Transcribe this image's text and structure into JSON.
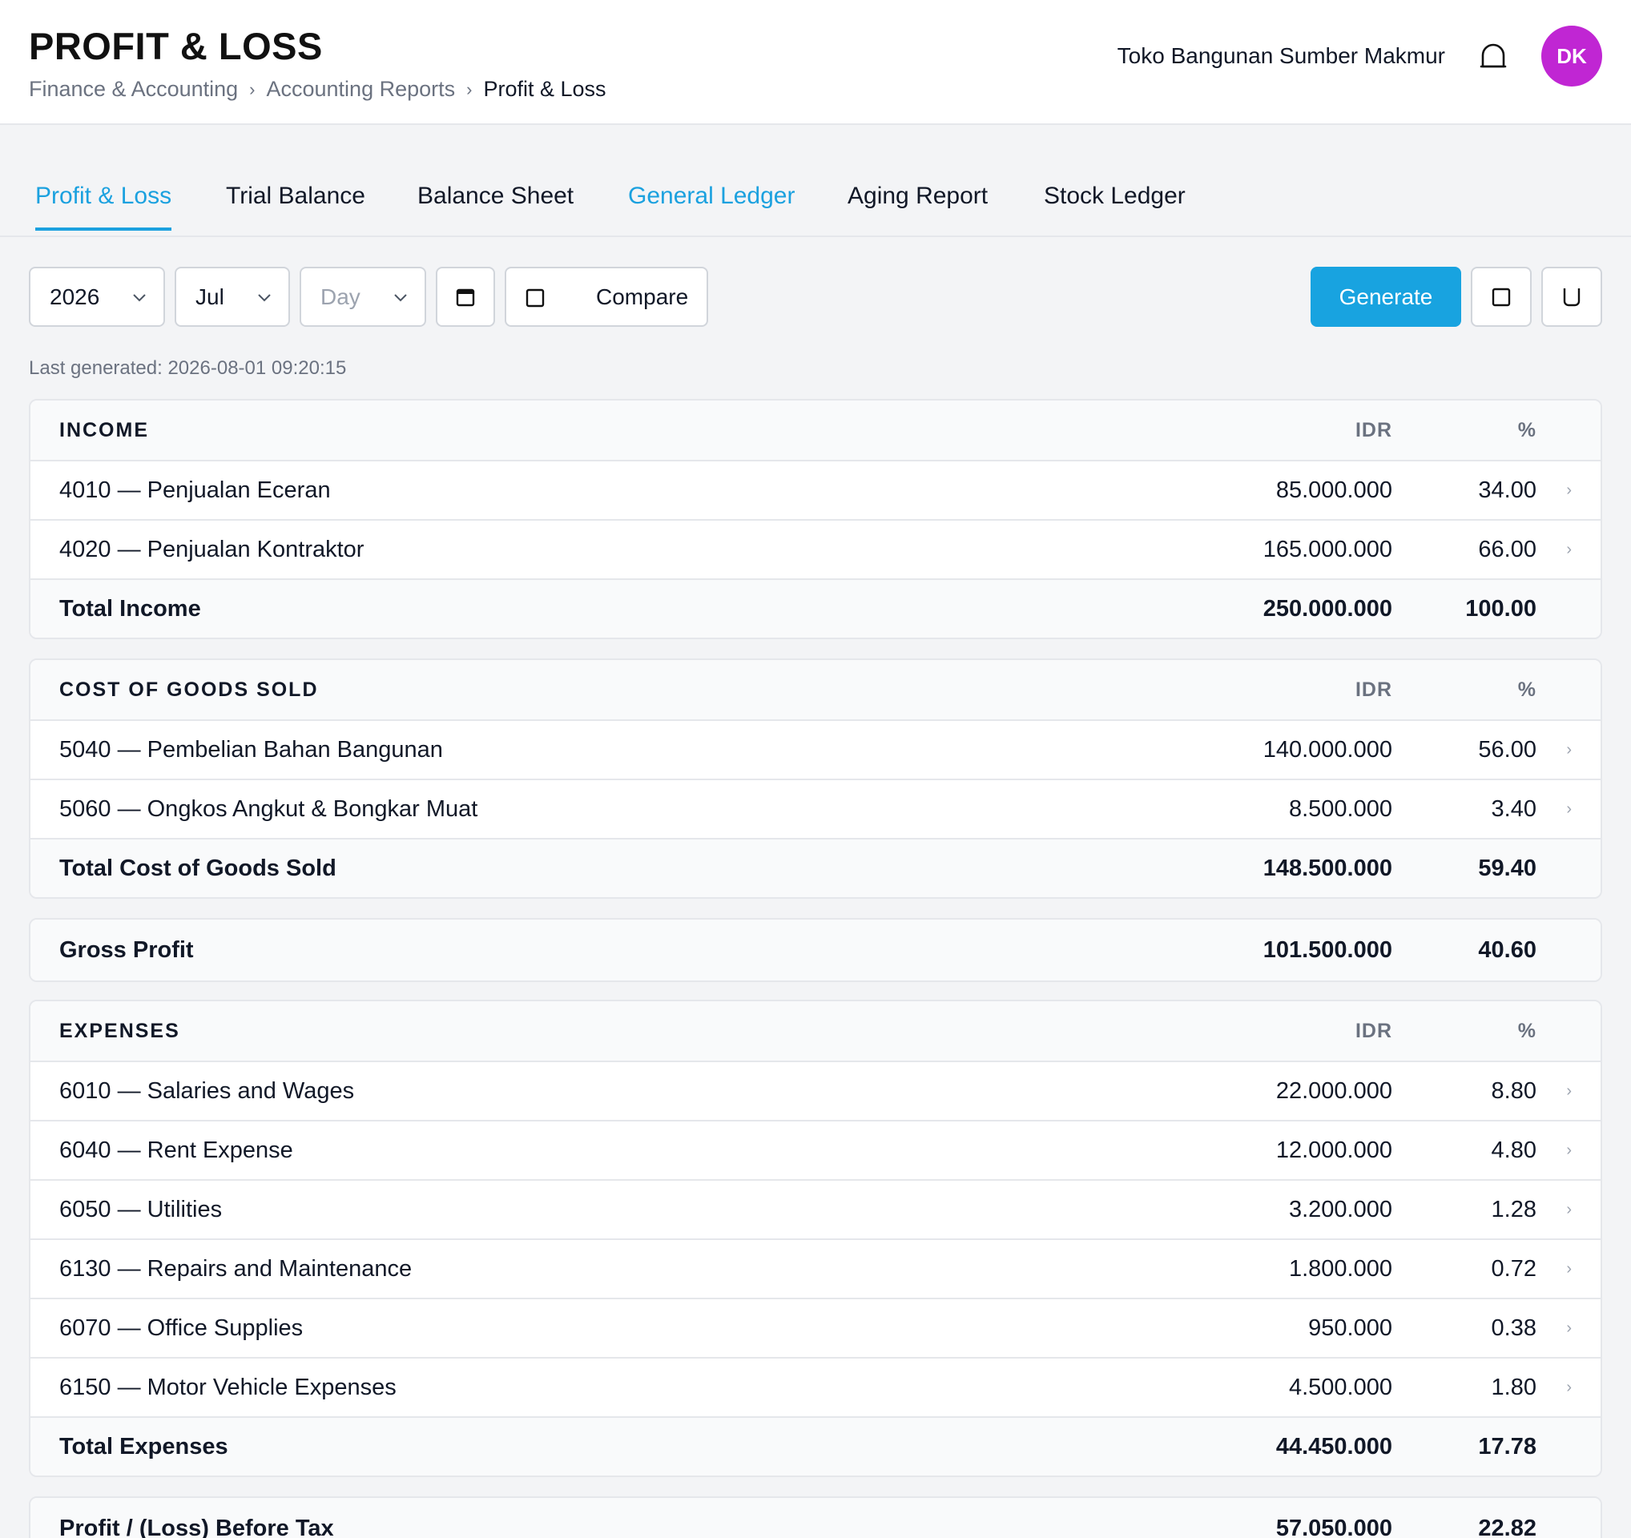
{
  "header": {
    "title": "PROFIT & LOSS",
    "breadcrumb": [
      "Finance & Accounting",
      "Accounting Reports",
      "Profit & Loss"
    ],
    "company": "Toko Bangunan Sumber Makmur",
    "avatar_initials": "DK",
    "avatar_color": "#c026d3"
  },
  "tabs": [
    "Profit & Loss",
    "Trial Balance",
    "Balance Sheet",
    "General Ledger",
    "Aging Report",
    "Stock Ledger"
  ],
  "filters": {
    "year": "2026",
    "month": "Jul",
    "day_placeholder": "Day",
    "compare_label": "Compare",
    "generate_label": "Generate"
  },
  "last_generated": "Last generated: 2026-08-01 09:20:15",
  "columns": {
    "amount": "IDR",
    "percent": "%"
  },
  "income": {
    "title": "INCOME",
    "rows": [
      {
        "label": "4010 — Penjualan Eceran",
        "amount": "85.000.000",
        "percent": "34.00"
      },
      {
        "label": "4020 — Penjualan Kontraktor",
        "amount": "165.000.000",
        "percent": "66.00"
      }
    ],
    "total": {
      "label": "Total Income",
      "amount": "250.000.000",
      "percent": "100.00"
    }
  },
  "cogs": {
    "title": "COST OF GOODS SOLD",
    "rows": [
      {
        "label": "5040 — Pembelian Bahan Bangunan",
        "amount": "140.000.000",
        "percent": "56.00"
      },
      {
        "label": "5060 — Ongkos Angkut & Bongkar Muat",
        "amount": "8.500.000",
        "percent": "3.40"
      }
    ],
    "total": {
      "label": "Total Cost of Goods Sold",
      "amount": "148.500.000",
      "percent": "59.40"
    }
  },
  "gross_profit": {
    "label": "Gross Profit",
    "amount": "101.500.000",
    "percent": "40.60"
  },
  "expenses": {
    "title": "EXPENSES",
    "rows": [
      {
        "label": "6010 — Salaries and Wages",
        "amount": "22.000.000",
        "percent": "8.80"
      },
      {
        "label": "6040 — Rent Expense",
        "amount": "12.000.000",
        "percent": "4.80"
      },
      {
        "label": "6050 — Utilities",
        "amount": "3.200.000",
        "percent": "1.28"
      },
      {
        "label": "6130 — Repairs and Maintenance",
        "amount": "1.800.000",
        "percent": "0.72"
      },
      {
        "label": "6070 — Office Supplies",
        "amount": "950.000",
        "percent": "0.38"
      },
      {
        "label": "6150 — Motor Vehicle Expenses",
        "amount": "4.500.000",
        "percent": "1.80"
      }
    ],
    "total": {
      "label": "Total Expenses",
      "amount": "44.450.000",
      "percent": "17.78"
    }
  },
  "profit_before_tax": {
    "label": "Profit / (Loss) Before Tax",
    "amount": "57.050.000",
    "percent": "22.82"
  },
  "colors": {
    "accent": "#1ba1df",
    "primary_button": "#18a3e0"
  }
}
